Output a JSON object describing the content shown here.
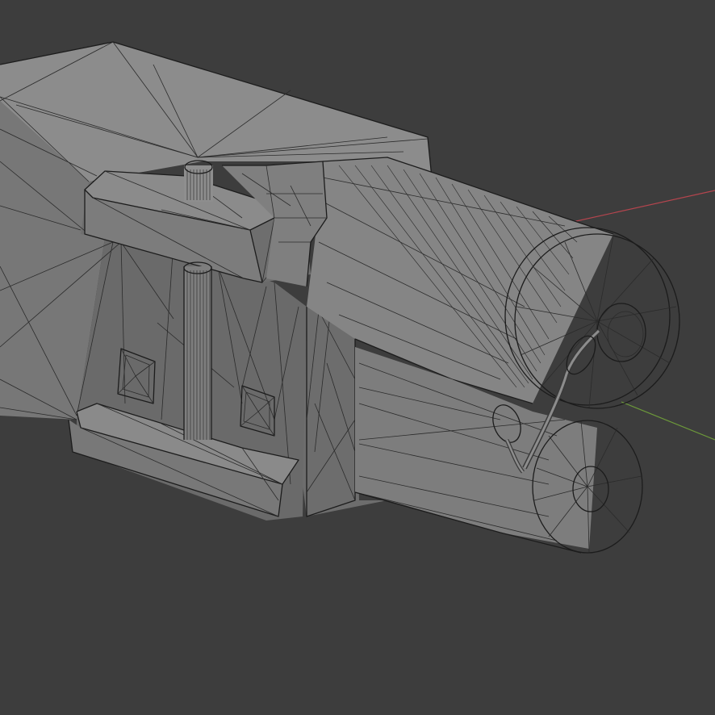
{
  "viewport": {
    "background_color": "#3d3d3d",
    "mode": "wireframe-overlay"
  },
  "axes": {
    "x_axis_color": "#b5454e",
    "y_axis_color": "#6d9a3a"
  },
  "mesh": {
    "shade_light": "#8a8a8a",
    "shade_mid": "#7a7a7a",
    "shade_dark": "#5e5e5e",
    "wire_color": "#2b2b2b"
  }
}
